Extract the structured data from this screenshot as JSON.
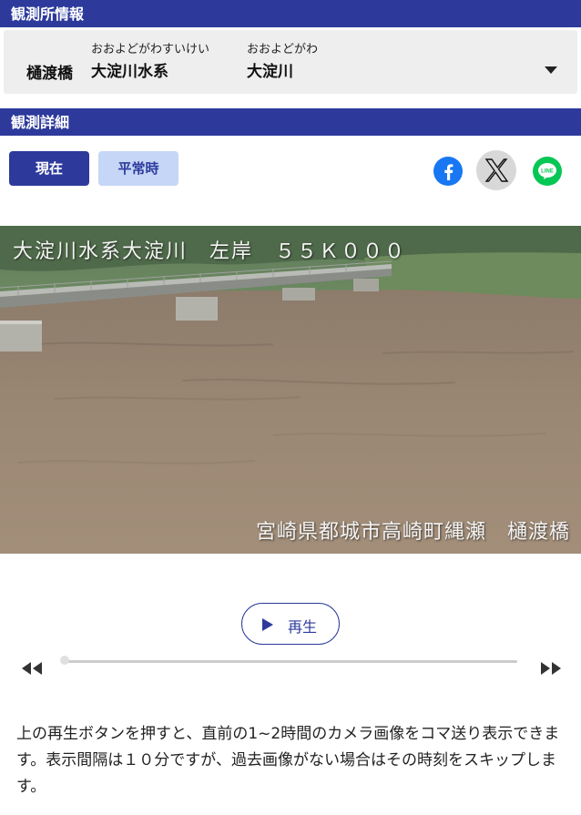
{
  "station_info": {
    "header": "観測所情報",
    "station_name": "樋渡橋",
    "system_ruby": "おおよどがわすいけい",
    "system_name": "大淀川水系",
    "river_ruby": "おおよどがわ",
    "river_name": "大淀川"
  },
  "detail": {
    "header": "観測詳細",
    "btn_now": "現在",
    "btn_normal": "平常時"
  },
  "share": {
    "facebook_icon": "facebook-icon",
    "x_icon": "x-icon",
    "line_icon": "line-icon",
    "line_text": "LINE"
  },
  "camera": {
    "overlay_top": "大淀川水系大淀川　左岸　５５Ｋ０００",
    "overlay_bottom": "宮崎県都城市高崎町縄瀬　樋渡橋"
  },
  "player": {
    "play_label": "再生",
    "position": 0
  },
  "description": "上の再生ボタンを押すと、直前の1~2時間のカメラ画像をコマ送り表示できます。表示間隔は１０分ですが、過去画像がない場合はその時刻をスキップします。",
  "colors": {
    "accent": "#2d3a9c",
    "secondary_button": "#c5d6f6",
    "facebook": "#1877f2",
    "line": "#06c755"
  }
}
